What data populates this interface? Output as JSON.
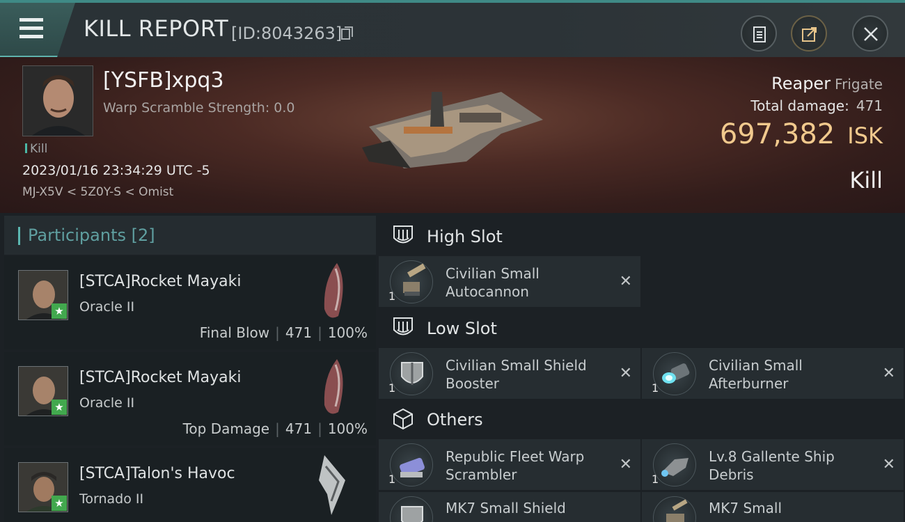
{
  "header": {
    "title": "KILL REPORT",
    "report_id": "[ID:8043263]"
  },
  "victim": {
    "name": "[YSFB]xpq3",
    "warp_scramble": "Warp Scramble Strength: 0.0",
    "tag": "Kill",
    "datetime": "2023/01/16 23:34:29 UTC -5",
    "location": "MJ-X5V < 5Z0Y-S < Omist",
    "ship_name": "Reaper",
    "ship_class": "Frigate",
    "total_damage_label": "Total damage:",
    "total_damage": "471",
    "isk_value": "697,382",
    "isk_unit": "ISK",
    "result": "Kill"
  },
  "participants": {
    "label": "Participants",
    "count": "[2]",
    "items": [
      {
        "name": "[STCA]Rocket Mayaki",
        "ship": "Oracle II",
        "role": "Final Blow",
        "damage": "471",
        "percent": "100%"
      },
      {
        "name": "[STCA]Rocket Mayaki",
        "ship": "Oracle II",
        "role": "Top Damage",
        "damage": "471",
        "percent": "100%"
      },
      {
        "name": "[STCA]Talon's Havoc",
        "ship": "Tornado II"
      }
    ]
  },
  "fitting": {
    "high_slot_label": "High Slot",
    "low_slot_label": "Low Slot",
    "others_label": "Others",
    "high": [
      {
        "name_line1": "Civilian Small",
        "name_line2": "Autocannon",
        "qty": "1"
      }
    ],
    "low": [
      {
        "name_line1": "Civilian Small Shield",
        "name_line2": "Booster",
        "qty": "1"
      },
      {
        "name_line1": "Civilian Small",
        "name_line2": "Afterburner",
        "qty": "1"
      }
    ],
    "others": [
      {
        "name_line1": "Republic Fleet Warp",
        "name_line2": "Scrambler",
        "qty": "1"
      },
      {
        "name_line1": "Lv.8 Gallente Ship",
        "name_line2": "Debris",
        "qty": "1"
      },
      {
        "name_line1": "MK7 Small Shield",
        "name_line2": "",
        "qty": ""
      },
      {
        "name_line1": "MK7 Small",
        "name_line2": "",
        "qty": ""
      }
    ],
    "remove_glyph": "✕"
  }
}
